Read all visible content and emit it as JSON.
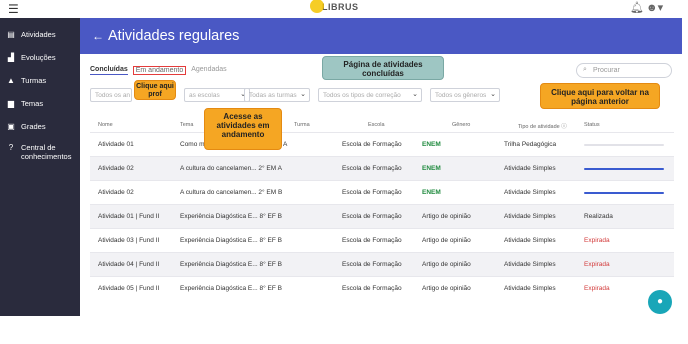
{
  "topbar": {
    "logo": "LIBRUS"
  },
  "sidebar": {
    "items": [
      {
        "label": "Atividades",
        "icon": "document-icon"
      },
      {
        "label": "Evoluções",
        "icon": "chart-icon"
      },
      {
        "label": "Turmas",
        "icon": "graduation-cap-icon"
      },
      {
        "label": "Temas",
        "icon": "folder-icon"
      },
      {
        "label": "Grades",
        "icon": "clipboard-icon"
      },
      {
        "label": "Central de conhecimentos",
        "icon": "question-icon"
      }
    ]
  },
  "header": {
    "title": "Atividades regulares"
  },
  "tabs": [
    "Concluídas",
    "Em andamento",
    "Agendadas"
  ],
  "search": {
    "placeholder": "Procurar"
  },
  "filters": {
    "f1": "Todos os an",
    "f2": "as escolas",
    "f3": "Todas as turmas",
    "f4": "Todos os tipos de correção",
    "f5": "Todos os gêneros"
  },
  "table": {
    "headers": [
      "Nome",
      "Tema",
      "Turma",
      "Escola",
      "Gênero",
      "Tipo de atividade ⓘ",
      "Status"
    ],
    "rows": [
      {
        "nome": "Atividade 01",
        "tema": "Como manter a saúde fis... 3° ANO A",
        "escola": "Escola de Formação",
        "genero": "ENEM",
        "tipo": "Trilha Pedagógica",
        "status": "",
        "progress": 0.0
      },
      {
        "nome": "Atividade 02",
        "tema": "A cultura do cancelamen... 2° EM A",
        "escola": "Escola de Formação",
        "genero": "ENEM",
        "tipo": "Atividade Simples",
        "status": "",
        "progress": 1.0
      },
      {
        "nome": "Atividade 02",
        "tema": "A cultura do cancelamen... 2° EM B",
        "escola": "Escola de Formação",
        "genero": "ENEM",
        "tipo": "Atividade Simples",
        "status": "",
        "progress": 1.0
      },
      {
        "nome": "Atividade 01 | Fund II",
        "tema": "Experiência Diagóstica E... 8° EF B",
        "escola": "Escola de Formação",
        "genero": "Artigo de opinião",
        "tipo": "Atividade Simples",
        "status": "Realizada",
        "progress": null
      },
      {
        "nome": "Atividade 03 | Fund II",
        "tema": "Experiência Diagóstica E... 8° EF B",
        "escola": "Escola de Formação",
        "genero": "Artigo de opinião",
        "tipo": "Atividade Simples",
        "status": "Expirada",
        "progress": null
      },
      {
        "nome": "Atividade 04 | Fund II",
        "tema": "Experiência Diagóstica E... 8° EF B",
        "escola": "Escola de Formação",
        "genero": "Artigo de opinião",
        "tipo": "Atividade Simples",
        "status": "Expirada",
        "progress": null
      },
      {
        "nome": "Atividade 05 | Fund II",
        "tema": "Experiência Diagóstica E... 8° EF B",
        "escola": "Escola de Formação",
        "genero": "Artigo de opinião",
        "tipo": "Atividade Simples",
        "status": "Expirada",
        "progress": null
      }
    ]
  },
  "callouts": {
    "clique_aqui_prof": "Clique aqui prof",
    "acesse": "Acesse as atividades em andamento",
    "pagina": "Página de atividades concluídas",
    "voltar": "Clique aqui para voltar na página anterior"
  },
  "colors": {
    "accent": "#4a58c4",
    "sidebar": "#2a2b3d",
    "callout": "#f5a623",
    "enem": "#1e8a3d",
    "expired": "#d33b3b"
  }
}
